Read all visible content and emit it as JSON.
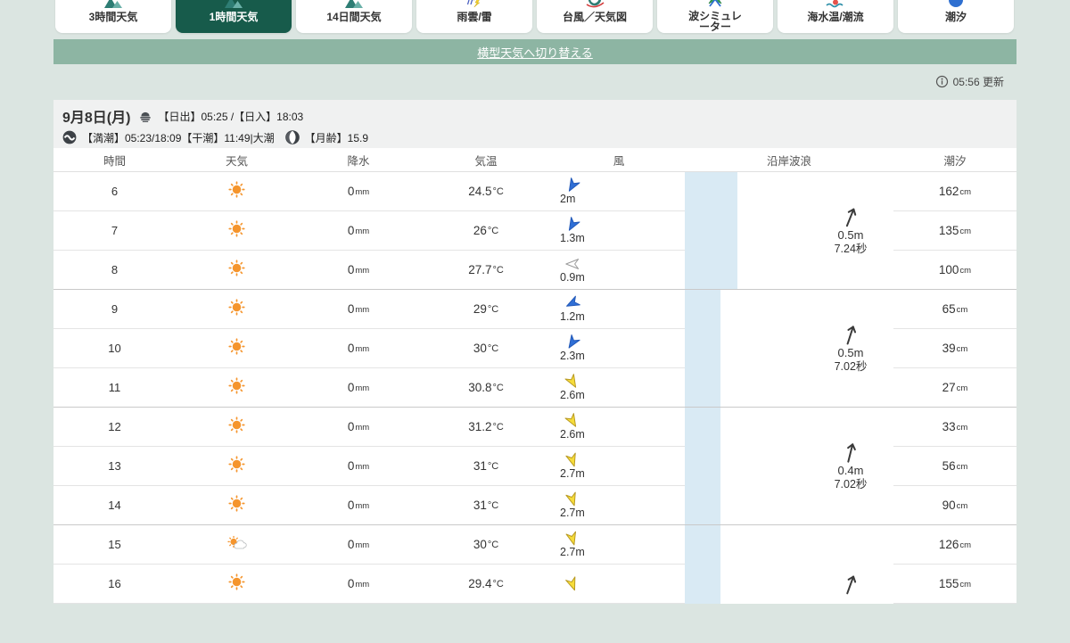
{
  "tabs": {
    "items": [
      {
        "label": "3時間天気",
        "icon": "weather-3h",
        "active": false,
        "narrow": false
      },
      {
        "label": "1時間天気",
        "icon": "weather-1h",
        "active": true,
        "narrow": false
      },
      {
        "label": "14日間天気",
        "icon": "weather-14d",
        "active": false,
        "narrow": false
      },
      {
        "label": "雨雲/雷",
        "icon": "rain-radar",
        "active": false,
        "narrow": false
      },
      {
        "label": "台風／天気図",
        "icon": "typhoon",
        "active": false,
        "narrow": false
      },
      {
        "label": "波シミュレーター",
        "icon": "wave-simulator",
        "active": false,
        "narrow": true
      },
      {
        "label": "海水温/潮流",
        "icon": "sea-temp",
        "active": false,
        "narrow": false
      },
      {
        "label": "潮汐",
        "icon": "tide",
        "active": false,
        "narrow": false
      }
    ]
  },
  "banner": {
    "link_label": "横型天気へ切り替える"
  },
  "update": {
    "time_label": "05:56 更新"
  },
  "date_header": {
    "date": "9月8日(月)",
    "sun_info": "【日出】05:25 /【日入】18:03",
    "tide_info": "【満潮】05:23/18:09【干潮】11:49|大潮",
    "moon_info": "【月齢】15.9"
  },
  "table": {
    "headers": [
      "時間",
      "天気",
      "降水",
      "気温",
      "風",
      "沿岸波浪",
      "潮汐"
    ],
    "rows": [
      {
        "time": "6",
        "weather": "sunny",
        "precip": "0",
        "precip_unit": "mm",
        "temp": "24.5",
        "temp_unit": "°C",
        "wind_speed": "2m",
        "wind_color": "blue",
        "wind_dir_deg": 210,
        "tide": "162",
        "tide_unit": "cm",
        "group_end": false
      },
      {
        "time": "7",
        "weather": "sunny",
        "precip": "0",
        "precip_unit": "mm",
        "temp": "26",
        "temp_unit": "°C",
        "wind_speed": "1.3m",
        "wind_color": "blue",
        "wind_dir_deg": 210,
        "tide": "135",
        "tide_unit": "cm",
        "group_end": false
      },
      {
        "time": "8",
        "weather": "sunny",
        "precip": "0",
        "precip_unit": "mm",
        "temp": "27.7",
        "temp_unit": "°C",
        "wind_speed": "0.9m",
        "wind_color": "white",
        "wind_dir_deg": 270,
        "tide": "100",
        "tide_unit": "cm",
        "group_end": true
      },
      {
        "time": "9",
        "weather": "sunny",
        "precip": "0",
        "precip_unit": "mm",
        "temp": "29",
        "temp_unit": "°C",
        "wind_speed": "1.2m",
        "wind_color": "blue",
        "wind_dir_deg": 243,
        "tide": "65",
        "tide_unit": "cm",
        "group_end": false
      },
      {
        "time": "10",
        "weather": "sunny",
        "precip": "0",
        "precip_unit": "mm",
        "temp": "30",
        "temp_unit": "°C",
        "wind_speed": "2.3m",
        "wind_color": "blue",
        "wind_dir_deg": 213,
        "tide": "39",
        "tide_unit": "cm",
        "group_end": false
      },
      {
        "time": "11",
        "weather": "sunny",
        "precip": "0",
        "precip_unit": "mm",
        "temp": "30.8",
        "temp_unit": "°C",
        "wind_speed": "2.6m",
        "wind_color": "yellow",
        "wind_dir_deg": 150,
        "tide": "27",
        "tide_unit": "cm",
        "group_end": true
      },
      {
        "time": "12",
        "weather": "sunny",
        "precip": "0",
        "precip_unit": "mm",
        "temp": "31.2",
        "temp_unit": "°C",
        "wind_speed": "2.6m",
        "wind_color": "yellow",
        "wind_dir_deg": 150,
        "tide": "33",
        "tide_unit": "cm",
        "group_end": false
      },
      {
        "time": "13",
        "weather": "sunny",
        "precip": "0",
        "precip_unit": "mm",
        "temp": "31",
        "temp_unit": "°C",
        "wind_speed": "2.7m",
        "wind_color": "yellow",
        "wind_dir_deg": 163,
        "tide": "56",
        "tide_unit": "cm",
        "group_end": false
      },
      {
        "time": "14",
        "weather": "sunny",
        "precip": "0",
        "precip_unit": "mm",
        "temp": "31",
        "temp_unit": "°C",
        "wind_speed": "2.7m",
        "wind_color": "yellow",
        "wind_dir_deg": 163,
        "tide": "90",
        "tide_unit": "cm",
        "group_end": true
      },
      {
        "time": "15",
        "weather": "sun-cloud",
        "precip": "0",
        "precip_unit": "mm",
        "temp": "30",
        "temp_unit": "°C",
        "wind_speed": "2.7m",
        "wind_color": "yellow",
        "wind_dir_deg": 165,
        "tide": "126",
        "tide_unit": "cm",
        "group_end": false
      },
      {
        "time": "16",
        "weather": "sunny",
        "precip": "0",
        "precip_unit": "mm",
        "temp": "29.4",
        "temp_unit": "°C",
        "wind_speed": "",
        "wind_color": "yellow",
        "wind_dir_deg": 160,
        "tide": "155",
        "tide_unit": "cm",
        "group_end": false
      }
    ],
    "wave_groups": [
      {
        "start": 0,
        "span": 3,
        "height": "0.5m",
        "period": "7.24秒",
        "arrow_deg": 22
      },
      {
        "start": 3,
        "span": 3,
        "height": "0.5m",
        "period": "7.02秒",
        "arrow_deg": 18
      },
      {
        "start": 6,
        "span": 3,
        "height": "0.4m",
        "period": "7.02秒",
        "arrow_deg": 14
      },
      {
        "start": 9,
        "span": 3,
        "height": "",
        "period": "",
        "arrow_deg": 20
      }
    ]
  }
}
